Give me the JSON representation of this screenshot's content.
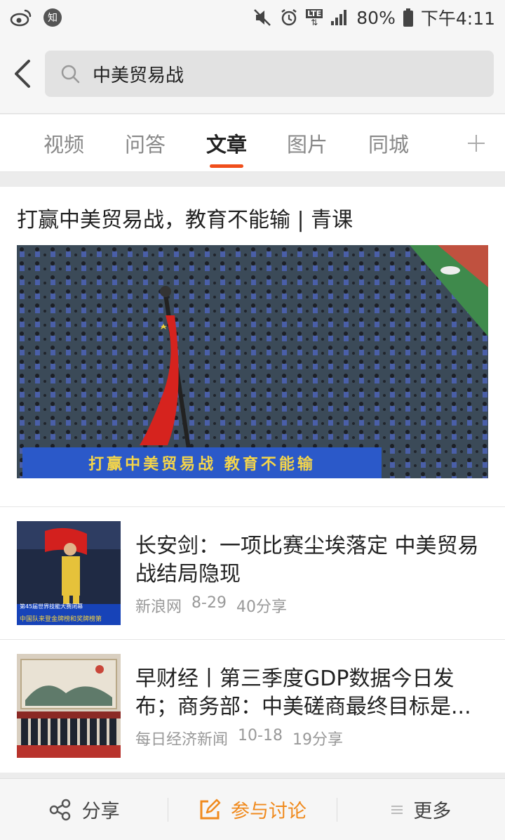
{
  "status_bar": {
    "battery": "80%",
    "time": "下午4:11",
    "left_icons": [
      "weibo-icon",
      "zhihu-icon"
    ],
    "right_icons": [
      "mute-icon",
      "alarm-icon",
      "lte-icon",
      "signal-icon",
      "battery-icon"
    ],
    "zhihu_label": "知",
    "lte_label": "LTE"
  },
  "search": {
    "query": "中美贸易战"
  },
  "tabs": [
    {
      "label": "视频",
      "active": false
    },
    {
      "label": "问答",
      "active": false
    },
    {
      "label": "文章",
      "active": true
    },
    {
      "label": "图片",
      "active": false
    },
    {
      "label": "同城",
      "active": false
    }
  ],
  "feature": {
    "title": "打赢中美贸易战，教育不能输 | 青课",
    "image_caption": "打赢中美贸易战  教育不能输"
  },
  "articles": [
    {
      "title": "长安剑：一项比赛尘埃落定 中美贸易战结局隐现",
      "source": "新浪网",
      "date": "8-29",
      "shares": "40分享",
      "thumb_caption_1": "第45届世界技能大赛闭幕",
      "thumb_caption_2": "中国队来登金牌榜和奖牌榜第"
    },
    {
      "title": "早财经丨第三季度GDP数据今日发布；商务部：中美磋商最终目标是...",
      "source": "每日经济新闻",
      "date": "10-18",
      "shares": "19分享"
    }
  ],
  "bottom_bar": {
    "share_label": "分享",
    "discuss_label": "参与讨论",
    "more_label": "更多"
  },
  "colors": {
    "accent": "#f04e1b",
    "discuss": "#f08a1d"
  }
}
